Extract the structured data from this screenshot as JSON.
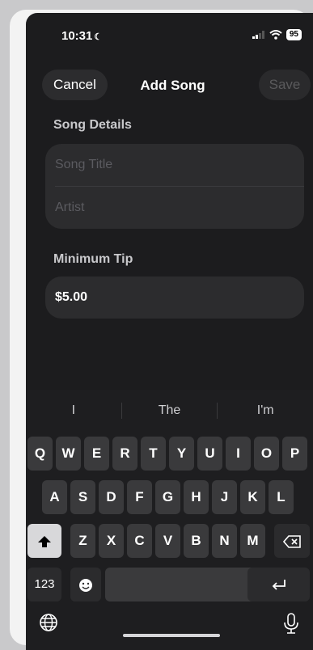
{
  "status": {
    "time": "10:31",
    "battery": "95"
  },
  "nav": {
    "cancel": "Cancel",
    "title": "Add Song",
    "save": "Save"
  },
  "form": {
    "section_details": "Song Details",
    "title_placeholder": "Song Title",
    "artist_placeholder": "Artist",
    "section_tip": "Minimum Tip",
    "tip_value": "$5.00"
  },
  "keyboard": {
    "suggestions": [
      "I",
      "The",
      "I'm"
    ],
    "row1": [
      "Q",
      "W",
      "E",
      "R",
      "T",
      "Y",
      "U",
      "I",
      "O",
      "P"
    ],
    "row2": [
      "A",
      "S",
      "D",
      "F",
      "G",
      "H",
      "J",
      "K",
      "L"
    ],
    "row3": [
      "Z",
      "X",
      "C",
      "V",
      "B",
      "N",
      "M"
    ],
    "numbers_key": "123",
    "icons": {
      "shift": "shift-icon",
      "delete": "delete-icon",
      "emoji": "emoji-icon",
      "return": "return-icon",
      "globe": "globe-icon",
      "mic": "microphone-icon"
    }
  }
}
